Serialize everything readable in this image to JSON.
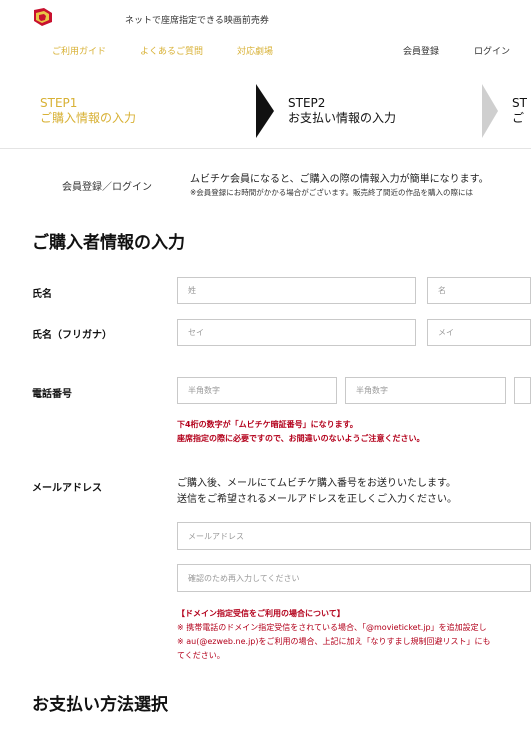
{
  "header": {
    "tagline": "ネットで座席指定できる映画前売券",
    "nav_left": [
      "ご利用ガイド",
      "よくあるご質問",
      "対応劇場"
    ],
    "nav_right": [
      "会員登録",
      "ログイン"
    ]
  },
  "steps": [
    {
      "title": "STEP1",
      "subtitle": "ご購入情報の入力"
    },
    {
      "title": "STEP2",
      "subtitle": "お支払い情報の入力"
    },
    {
      "title": "ST",
      "subtitle": "ご"
    }
  ],
  "login": {
    "link": "会員登録／ログイン",
    "message": "ムビチケ会員になると、ご購入の際の情報入力が簡単になります。",
    "note": "※会員登録にお時間がかかる場合がございます。販売終了間近の作品を購入の際には"
  },
  "purchaser": {
    "heading": "ご購入者情報の入力",
    "name_label": "氏名",
    "name_last_placeholder": "姓",
    "name_first_placeholder": "名",
    "kana_label": "氏名（フリガナ）",
    "kana_last_placeholder": "セイ",
    "kana_first_placeholder": "メイ",
    "phone_label": "電話番号",
    "phone_placeholder_1": "半角数字",
    "phone_placeholder_2": "半角数字",
    "phone_note_1": "下4桁の数字が「ムビチケ暗証番号」になります。",
    "phone_note_2": "座席指定の際に必要ですので、お間違いのないようご注意ください。",
    "email_label": "メールアドレス",
    "email_desc_1": "ご購入後、メールにてムビチケ購入番号をお送りいたします。",
    "email_desc_2": "送信をご希望されるメールアドレスを正しくご入力ください。",
    "email_placeholder": "メールアドレス",
    "email_confirm_placeholder": "確認のため再入力してください",
    "domain_title": "【ドメイン指定受信をご利用の場合について】",
    "domain_note_1": "※ 携帯電話のドメイン指定受信をされている場合、「@movieticket.jp」を追加設定し",
    "domain_note_2": "※ au(@ezweb.ne.jp)をご利用の場合、上記に加え「なりすまし規制回避リスト」にも",
    "domain_note_3": "てください。"
  },
  "payment": {
    "heading": "お支払い方法選択"
  },
  "colors": {
    "gold": "#d8b135",
    "red": "#b3001b",
    "accent": "#111111"
  }
}
